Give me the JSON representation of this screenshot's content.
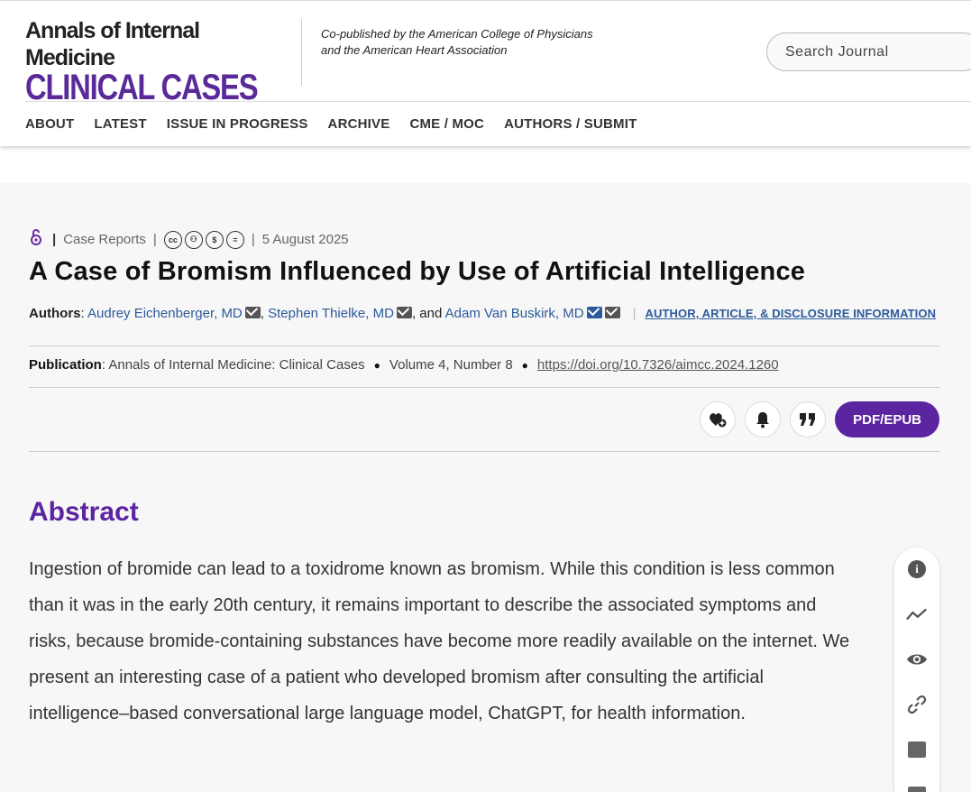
{
  "header": {
    "logo_line1": "Annals of Internal Medicine",
    "logo_line2": "CLINICAL CASES",
    "copublished": "Co-published by the American College of Physicians and the American Heart Association",
    "search_placeholder": "Search Journal",
    "nav": [
      "ABOUT",
      "LATEST",
      "ISSUE IN PROGRESS",
      "ARCHIVE",
      "CME / MOC",
      "AUTHORS / SUBMIT"
    ]
  },
  "article": {
    "type": "Case Reports",
    "date": "5 August 2025",
    "license_icons": [
      "cc",
      "by",
      "nc",
      "nd"
    ],
    "title": "A Case of Bromism Influenced by Use of Artificial Intelligence",
    "authors_label": "Authors",
    "authors": [
      "Audrey Eichenberger, MD",
      "Stephen Thielke, MD",
      "Adam Van Buskirk, MD"
    ],
    "authors_and": ", and ",
    "disclosure_link": "AUTHOR, ARTICLE, & DISCLOSURE INFORMATION",
    "publication_label": "Publication",
    "publication": "Annals of Internal Medicine: Clinical Cases",
    "volume": "Volume 4, Number 8",
    "doi": "https://doi.org/10.7326/aimcc.2024.1260",
    "pdf_button": "PDF/EPUB",
    "abstract_heading": "Abstract",
    "abstract_text": "Ingestion of bromide can lead to a toxidrome known as bromism. While this condition is less common than it was in the early 20th century, it remains important to describe the associated symptoms and risks, because bromide-containing substances have become more readily available on the internet. We present an interesting case of a patient who developed bromism after consulting the artificial intelligence–based conversational large language model, ChatGPT, for health information."
  },
  "colors": {
    "brand_purple": "#5b24a0",
    "link_blue": "#2c5a9c"
  }
}
